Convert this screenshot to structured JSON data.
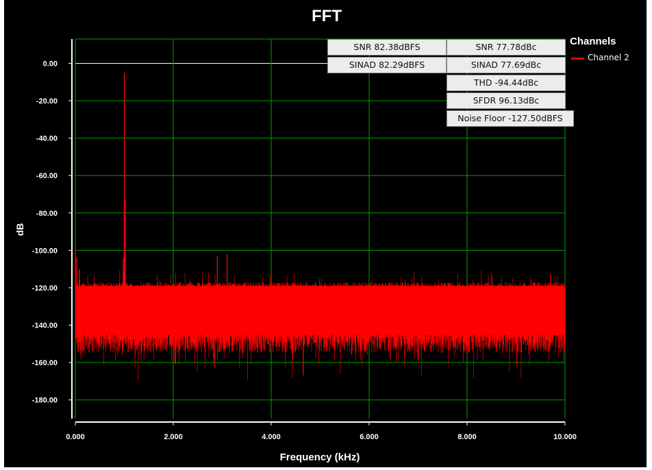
{
  "chart_data": {
    "type": "line",
    "title": "FFT",
    "xlabel": "Frequency (kHz)",
    "ylabel": "dB",
    "xlim": [
      0,
      10
    ],
    "ylim": [
      -190,
      13
    ],
    "grid": true,
    "x_ticks": [
      0,
      2,
      4,
      6,
      8,
      10
    ],
    "x_tick_labels": [
      "0.000",
      "2.000",
      "4.000",
      "6.000",
      "8.000",
      "10.000"
    ],
    "y_ticks": [
      0,
      -20,
      -40,
      -60,
      -80,
      -100,
      -120,
      -140,
      -160,
      -180
    ],
    "y_tick_labels": [
      "0.00",
      "-20.00",
      "-40.00",
      "-60.00",
      "-80.00",
      "-100.00",
      "-120.00",
      "-140.00",
      "-160.00",
      "-180.00"
    ],
    "reference_line": 0,
    "legend": {
      "title": "Channels",
      "position": "top-right"
    },
    "series": [
      {
        "name": "Channel 2",
        "color": "#ff0000",
        "noise_band": {
          "upper": -120,
          "lower": -145,
          "min_dip": -170
        },
        "x": [
          0.0,
          0.03,
          0.08,
          0.15,
          0.3,
          0.6,
          0.9,
          0.95,
          0.98,
          1.0,
          1.02,
          1.05,
          1.2,
          1.5,
          2.0,
          2.5,
          2.9,
          3.0,
          3.1,
          4.0,
          5.0,
          6.0,
          7.0,
          8.0,
          9.0,
          10.0
        ],
        "values": [
          -98,
          -104,
          -110,
          -118,
          -122,
          -124,
          -126,
          -118,
          -104,
          -5,
          -73,
          -118,
          -126,
          -128,
          -128,
          -128,
          -103,
          -126,
          -102,
          -128,
          -128,
          -128,
          -128,
          -128,
          -128,
          -128
        ]
      }
    ]
  },
  "metrics": {
    "snr_dbfs": "SNR 82.38dBFS",
    "snr_dbc": "SNR 77.78dBc",
    "sinad_dbfs": "SINAD 82.29dBFS",
    "sinad_dbc": "SINAD 77.69dBc",
    "thd": "THD -94.44dBc",
    "sfdr": "SFDR 96.13dBc",
    "noise_floor": "Noise Floor -127.50dBFS"
  },
  "colors": {
    "background": "#000000",
    "grid": "#00a000",
    "axis": "#ffffff",
    "series": "#ff0000"
  }
}
